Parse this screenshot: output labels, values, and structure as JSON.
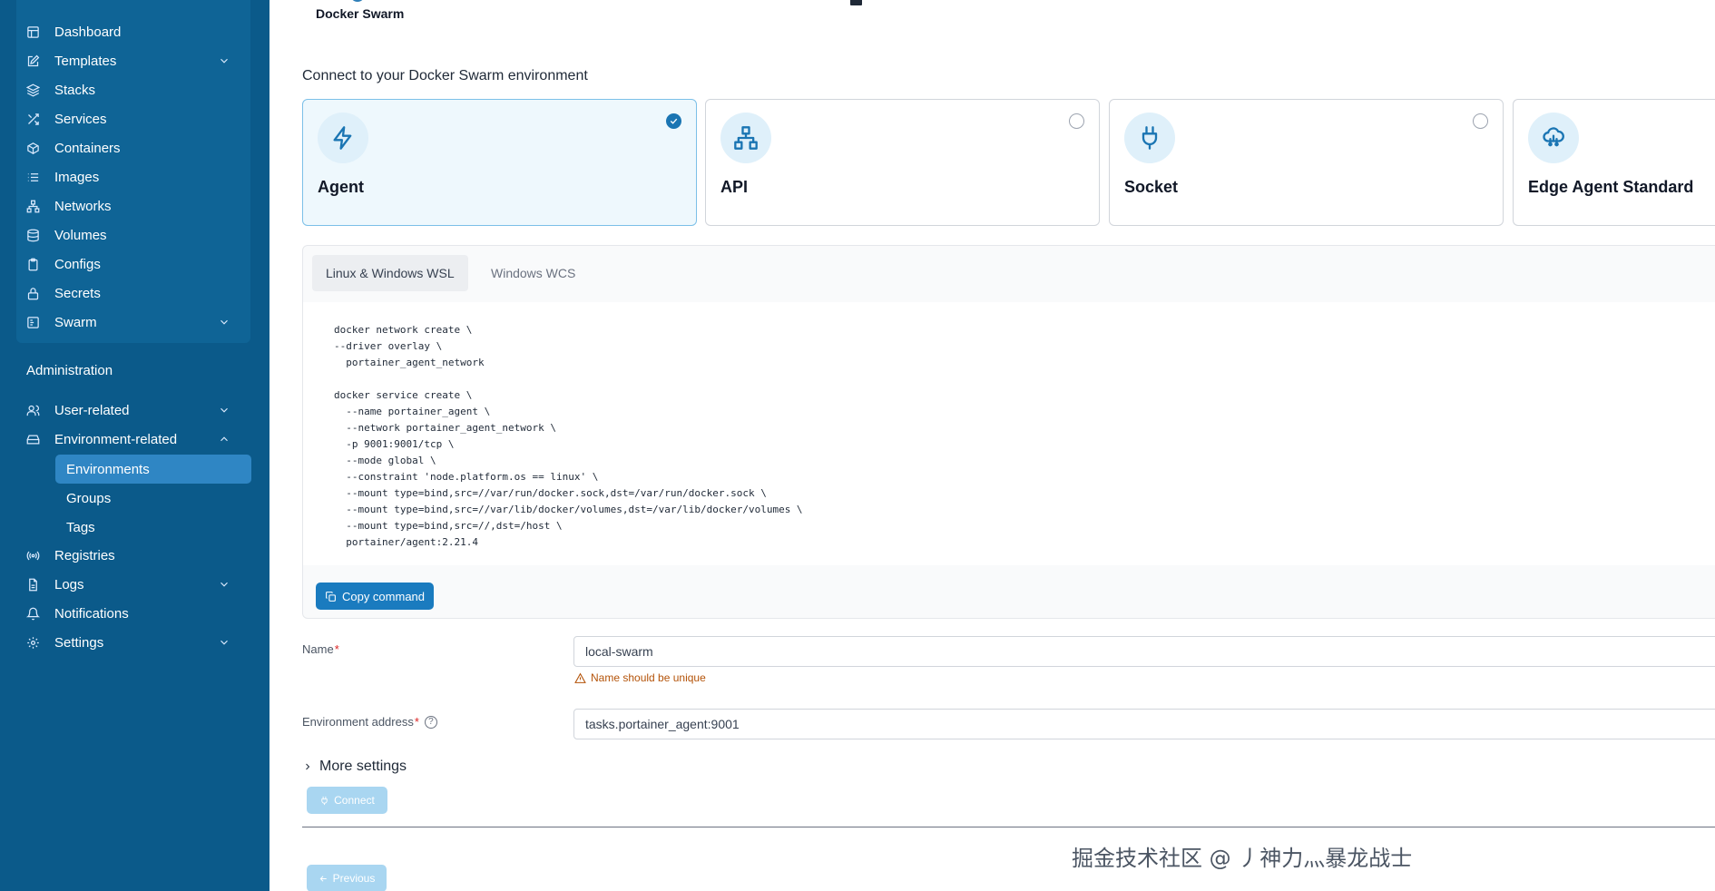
{
  "header": {
    "title": "Docker Swarm"
  },
  "sidebar": {
    "items": [
      {
        "label": "Dashboard",
        "icon": "dashboard-icon",
        "has_chevron": false
      },
      {
        "label": "Templates",
        "icon": "edit-icon",
        "has_chevron": true
      },
      {
        "label": "Stacks",
        "icon": "layers-icon",
        "has_chevron": false
      },
      {
        "label": "Services",
        "icon": "shuffle-icon",
        "has_chevron": false
      },
      {
        "label": "Containers",
        "icon": "box-icon",
        "has_chevron": false
      },
      {
        "label": "Images",
        "icon": "list-icon",
        "has_chevron": false
      },
      {
        "label": "Networks",
        "icon": "network-icon",
        "has_chevron": false
      },
      {
        "label": "Volumes",
        "icon": "database-icon",
        "has_chevron": false
      },
      {
        "label": "Configs",
        "icon": "clipboard-icon",
        "has_chevron": false
      },
      {
        "label": "Secrets",
        "icon": "lock-icon",
        "has_chevron": false
      },
      {
        "label": "Swarm",
        "icon": "swarm-icon",
        "has_chevron": true
      }
    ],
    "admin_heading": "Administration",
    "admin_items": [
      {
        "label": "User-related",
        "icon": "users-icon",
        "has_chevron": true
      },
      {
        "label": "Environment-related",
        "icon": "hard-drive-icon",
        "has_chevron": true,
        "expanded": true
      }
    ],
    "env_sub_items": [
      {
        "label": "Environments",
        "active": true
      },
      {
        "label": "Groups"
      },
      {
        "label": "Tags"
      }
    ],
    "bottom_items": [
      {
        "label": "Registries",
        "icon": "radio-icon",
        "has_chevron": false
      },
      {
        "label": "Logs",
        "icon": "file-icon",
        "has_chevron": true
      },
      {
        "label": "Notifications",
        "icon": "bell-icon",
        "has_chevron": false
      },
      {
        "label": "Settings",
        "icon": "gear-icon",
        "has_chevron": true
      }
    ]
  },
  "main": {
    "section_label": "Connect to your Docker Swarm environment",
    "options": [
      {
        "label": "Agent",
        "icon": "zap-icon",
        "selected": true
      },
      {
        "label": "API",
        "icon": "network-icon",
        "selected": false
      },
      {
        "label": "Socket",
        "icon": "plug-icon",
        "selected": false
      },
      {
        "label": "Edge Agent Standard",
        "icon": "cloud-icon",
        "selected": false
      }
    ],
    "tabs": [
      {
        "label": "Linux & Windows WSL",
        "active": true
      },
      {
        "label": "Windows WCS",
        "active": false
      }
    ],
    "command": "docker network create \\\n--driver overlay \\\n  portainer_agent_network\n\ndocker service create \\\n  --name portainer_agent \\\n  --network portainer_agent_network \\\n  -p 9001:9001/tcp \\\n  --mode global \\\n  --constraint 'node.platform.os == linux' \\\n  --mount type=bind,src=//var/run/docker.sock,dst=/var/run/docker.sock \\\n  --mount type=bind,src=//var/lib/docker/volumes,dst=/var/lib/docker/volumes \\\n  --mount type=bind,src=//,dst=/host \\\n  portainer/agent:2.21.4",
    "copy_button": "Copy command",
    "name_label": "Name",
    "name_required": "*",
    "name_value": "local-swarm",
    "name_warning": "Name should be unique",
    "address_label": "Environment address",
    "address_required": "*",
    "address_help": "?",
    "address_value": "tasks.portainer_agent:9001",
    "more_settings": "More settings",
    "connect_button": "Connect",
    "previous_button": "Previous"
  },
  "watermark": "掘金技术社区 @ 丿神力灬暴龙战士",
  "colors": {
    "sidebar_bg": "#0b5a8a",
    "accent": "#1a7bbf",
    "selected_card_bg": "#eef8fd",
    "warning": "#b45309"
  }
}
